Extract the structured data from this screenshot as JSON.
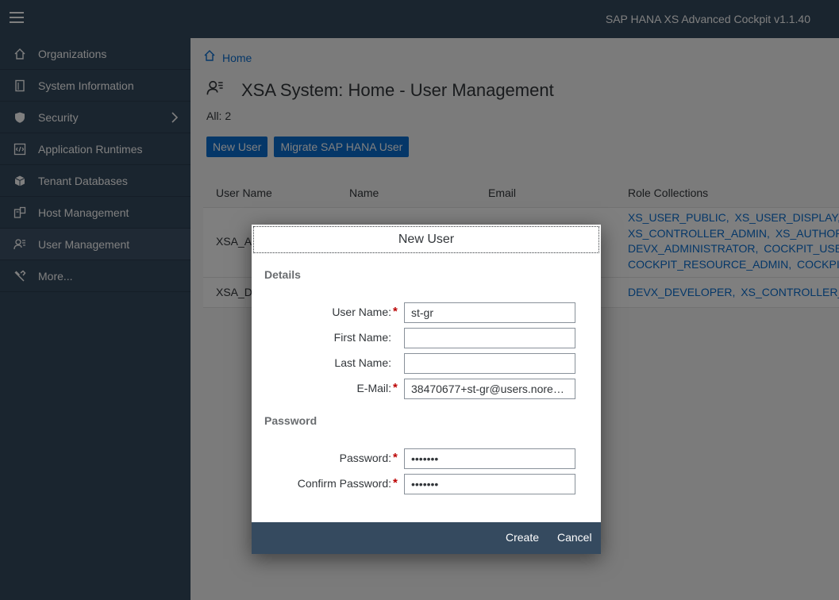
{
  "shell": {
    "title": "SAP HANA XS Advanced Cockpit v1.1.40"
  },
  "sidebar": {
    "items": [
      {
        "label": "Organizations",
        "icon": "home-icon"
      },
      {
        "label": "System Information",
        "icon": "document-icon"
      },
      {
        "label": "Security",
        "icon": "shield-icon"
      },
      {
        "label": "Application Runtimes",
        "icon": "code-icon"
      },
      {
        "label": "Tenant Databases",
        "icon": "database-icon"
      },
      {
        "label": "Host Management",
        "icon": "host-icon"
      },
      {
        "label": "User Management",
        "icon": "user-settings-icon",
        "active": true
      },
      {
        "label": "More...",
        "icon": "wrench-icon"
      }
    ]
  },
  "breadcrumb": {
    "home": "Home"
  },
  "page": {
    "title": "XSA System: Home - User Management",
    "count": "All: 2",
    "buttons": {
      "new_user": "New User",
      "migrate": "Migrate SAP HANA User"
    }
  },
  "table": {
    "headers": [
      "User Name",
      "Name",
      "Email",
      "Role Collections"
    ],
    "rows": [
      {
        "user_name": "XSA_A",
        "roles": [
          [
            "XS_USER_PUBLIC,",
            "XS_USER_DISPLAY,",
            "X"
          ],
          [
            "XS_CONTROLLER_ADMIN,",
            "XS_AUTHORIZ"
          ],
          [
            "DEVX_ADMINISTRATOR,",
            "COCKPIT_USER"
          ],
          [
            "COCKPIT_RESOURCE_ADMIN,",
            "COCKPIT_"
          ]
        ]
      },
      {
        "user_name": "XSA_D",
        "roles": [
          [
            "DEVX_DEVELOPER,",
            "XS_CONTROLLER_U"
          ]
        ]
      }
    ]
  },
  "dialog": {
    "title": "New User",
    "details_label": "Details",
    "password_label": "Password",
    "fields": {
      "user_name": {
        "label": "User Name:",
        "value": "st-gr",
        "required": true
      },
      "first_name": {
        "label": "First Name:",
        "value": ""
      },
      "last_name": {
        "label": "Last Name:",
        "value": ""
      },
      "email": {
        "label": "E-Mail:",
        "value": "38470677+st-gr@users.norep...",
        "required": true
      },
      "password": {
        "label": "Password:",
        "value": "•••••••",
        "required": true
      },
      "confirm_password": {
        "label": "Confirm Password:",
        "value": "•••••••",
        "required": true
      }
    },
    "required_marker": "*",
    "create": "Create",
    "cancel": "Cancel"
  },
  "colors": {
    "shell": "#354a5f",
    "accent": "#0a6ed1",
    "required": "#bb0000"
  }
}
